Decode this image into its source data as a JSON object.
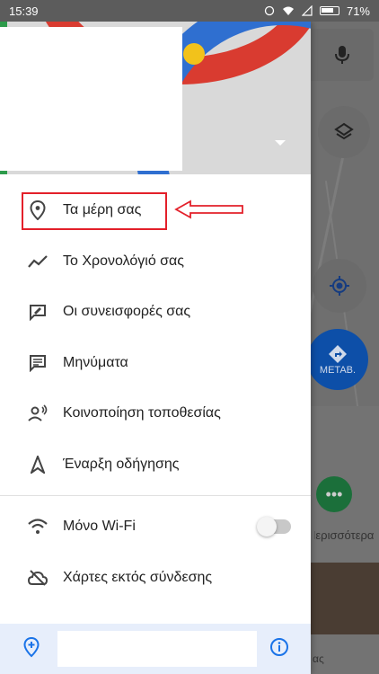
{
  "status_bar": {
    "time": "15:39",
    "battery": "71%"
  },
  "drawer": {
    "items": [
      {
        "label": "Τα μέρη σας",
        "icon": "place-pin-icon"
      },
      {
        "label": "Το Χρονολόγιό σας",
        "icon": "timeline-icon"
      },
      {
        "label": "Οι συνεισφορές σας",
        "icon": "contributions-icon"
      },
      {
        "label": "Μηνύματα",
        "icon": "message-icon"
      },
      {
        "label": "Κοινοποίηση τοποθεσίας",
        "icon": "location-sharing-icon"
      },
      {
        "label": "Έναρξη οδήγησης",
        "icon": "navigation-icon"
      },
      {
        "label": "Μόνο Wi-Fi",
        "icon": "wifi-icon"
      },
      {
        "label": "Χάρτες εκτός σύνδεσης",
        "icon": "offline-maps-icon"
      }
    ],
    "wifi_only_enabled": false
  },
  "map_overlay": {
    "directions_label": "ΜΕΤΑΒ.",
    "more_label": "Περισσότερα",
    "bottom_text": "ας"
  },
  "colors": {
    "highlight": "#e3202a",
    "accent_blue": "#1a73e8",
    "directions_bg": "#0d4fa8"
  }
}
